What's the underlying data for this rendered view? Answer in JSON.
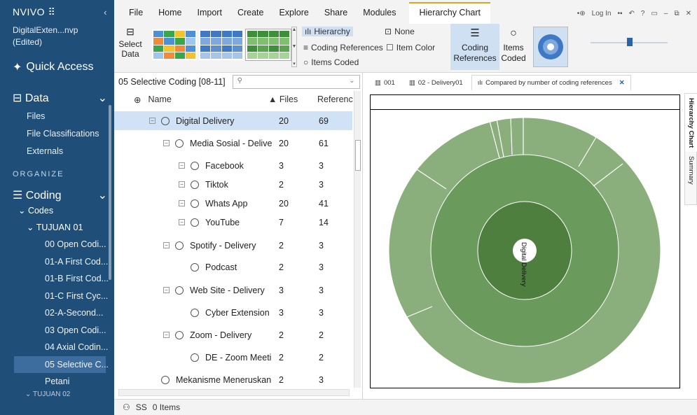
{
  "sidebar": {
    "brand": "NVIVO",
    "brand_mark": "⠿",
    "project": "DigitalExten...nvp",
    "project_state": "(Edited)",
    "quick_access": "Quick Access",
    "data": "Data",
    "data_items": [
      "Files",
      "File Classifications",
      "Externals"
    ],
    "organize": "ORGANIZE",
    "coding": "Coding",
    "codes": "Codes",
    "tujuan": "TUJUAN 01",
    "nodes": [
      "00 Open Codi...",
      "01-A First Cod...",
      "01-B First Cod...",
      "01-C First Cyc...",
      "02-A-Second...",
      "03 Open Codi...",
      "04 Axial Codin...",
      "05 Selective C...",
      "Petani"
    ],
    "next": "TUJUAN 02"
  },
  "ribbon": {
    "tabs": [
      "File",
      "Home",
      "Import",
      "Create",
      "Explore",
      "Share",
      "Modules"
    ],
    "active_tab": "Hierarchy Chart",
    "login": "Log In",
    "select_data": [
      "Select",
      "Data"
    ],
    "hierarchy": "Hierarchy",
    "coding_references": "Coding References",
    "items_coded": "Items Coded",
    "none": "None",
    "item_color": "Item Color",
    "btn_coding_refs": [
      "Coding",
      "References"
    ],
    "btn_items_coded": [
      "Items",
      "Coded"
    ]
  },
  "node_pane": {
    "title": "05 Selective Coding [08-11]",
    "col_name": "Name",
    "col_files": "Files",
    "col_refs": "Referenc",
    "rows": [
      {
        "name": "Digital Delivery",
        "files": "20",
        "refs": "69"
      },
      {
        "name": "Media Sosial - Delive",
        "files": "20",
        "refs": "61"
      },
      {
        "name": "Facebook",
        "files": "3",
        "refs": "3"
      },
      {
        "name": "Tiktok",
        "files": "2",
        "refs": "3"
      },
      {
        "name": "Whats App",
        "files": "20",
        "refs": "41"
      },
      {
        "name": "YouTube",
        "files": "7",
        "refs": "14"
      },
      {
        "name": "Spotify - Delivery",
        "files": "2",
        "refs": "3"
      },
      {
        "name": "Podcast",
        "files": "2",
        "refs": "3"
      },
      {
        "name": "Web Site - Delivery",
        "files": "3",
        "refs": "3"
      },
      {
        "name": "Cyber Extension",
        "files": "3",
        "refs": "3"
      },
      {
        "name": "Zoom - Delivery",
        "files": "2",
        "refs": "2"
      },
      {
        "name": "DE - Zoom Meeti",
        "files": "2",
        "refs": "2"
      },
      {
        "name": "Mekanisme Meneruskan",
        "files": "2",
        "refs": "3"
      }
    ]
  },
  "chart_tabs": [
    "001",
    "02 - Delivery01",
    "Compared by number of coding references"
  ],
  "side_tabs": [
    "Hierarchy Chart",
    "Summary"
  ],
  "chart_label": "Digital Delivery",
  "status": {
    "user": "SS",
    "items": "0 Items"
  }
}
